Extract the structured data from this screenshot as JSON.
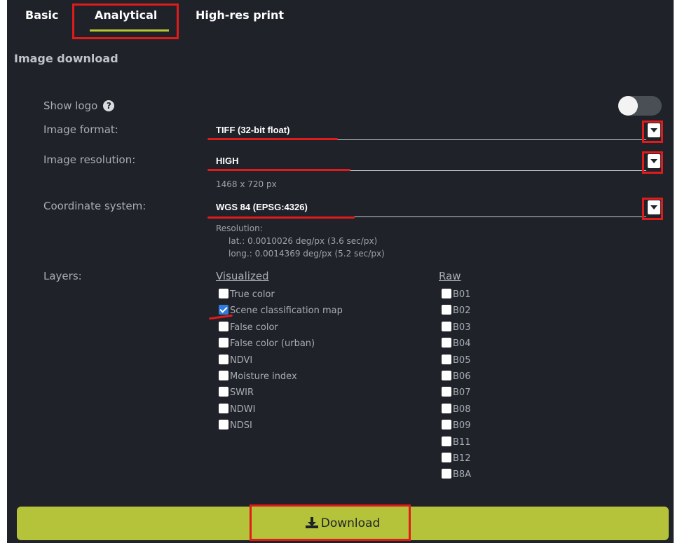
{
  "tabs": [
    {
      "label": "Basic"
    },
    {
      "label": "Analytical",
      "active": true
    },
    {
      "label": "High-res print"
    }
  ],
  "section_title": "Image download",
  "show_logo": {
    "label": "Show logo",
    "enabled": false,
    "help_icon": "question-circle-icon"
  },
  "image_format": {
    "label": "Image format:",
    "value": "TIFF (32-bit float)"
  },
  "image_resolution": {
    "label": "Image resolution:",
    "value": "HIGH",
    "note": "1468 x 720 px"
  },
  "coordinate_system": {
    "label": "Coordinate system:",
    "value": "WGS 84 (EPSG:4326)",
    "resolution_title": "Resolution:",
    "lat": "lat.: 0.0010026 deg/px (3.6 sec/px)",
    "long": "long.: 0.0014369 deg/px (5.2 sec/px)"
  },
  "layers": {
    "label": "Layers:",
    "visualized_title": "Visualized",
    "raw_title": "Raw",
    "visualized": [
      {
        "label": "True color",
        "checked": false
      },
      {
        "label": "Scene classification map",
        "checked": true
      },
      {
        "label": "False color",
        "checked": false
      },
      {
        "label": "False color (urban)",
        "checked": false
      },
      {
        "label": "NDVI",
        "checked": false
      },
      {
        "label": "Moisture index",
        "checked": false
      },
      {
        "label": "SWIR",
        "checked": false
      },
      {
        "label": "NDWI",
        "checked": false
      },
      {
        "label": "NDSI",
        "checked": false
      }
    ],
    "raw": [
      {
        "label": "B01"
      },
      {
        "label": "B02"
      },
      {
        "label": "B03"
      },
      {
        "label": "B04"
      },
      {
        "label": "B05"
      },
      {
        "label": "B06"
      },
      {
        "label": "B07"
      },
      {
        "label": "B08"
      },
      {
        "label": "B09"
      },
      {
        "label": "B11"
      },
      {
        "label": "B12"
      },
      {
        "label": "B8A"
      }
    ]
  },
  "download": {
    "label": "Download",
    "icon": "download-icon"
  },
  "colors": {
    "panel": "#1f2229",
    "accent": "#b6c630",
    "annotation": "#e01b1b",
    "checkbox_checked": "#2f7be0"
  }
}
